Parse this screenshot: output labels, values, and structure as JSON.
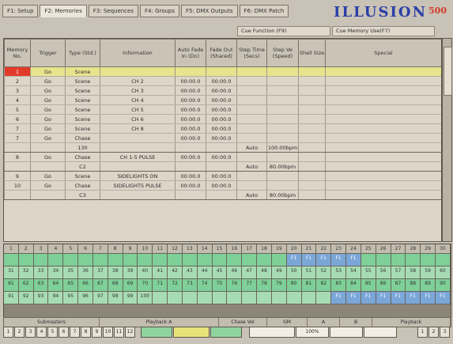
{
  "tabs": [
    "F1: Setup",
    "F2: Memories",
    "F3: Sequences",
    "F4: Groups",
    "F5: DMX Outputs",
    "F6: DMX Patch"
  ],
  "logo": {
    "main": "ILLUSION",
    "suffix": "500"
  },
  "subbar": {
    "left": "Cue Function (F9)",
    "right": "Cue Memory Use(F7)"
  },
  "headers": [
    "Memory No.",
    "Trigger",
    "Type (Std.)",
    "Information",
    "Auto Fade In (Dn)",
    "Fade Out (Shared)",
    "Step Time (Secs)",
    "Step Ve (Speed)",
    "Shell Size",
    "Special"
  ],
  "rows": [
    {
      "cells": [
        "1",
        "Go",
        "Scene",
        "",
        "",
        "",
        "",
        "",
        "",
        ""
      ],
      "selected": true
    },
    {
      "cells": [
        "2",
        "Go",
        "Scene",
        "CH 2",
        "00:00.0",
        "00:00.0",
        "",
        "",
        "",
        ""
      ]
    },
    {
      "cells": [
        "3",
        "Go",
        "Scene",
        "CH 3",
        "00:00.0",
        "00:00.0",
        "",
        "",
        "",
        ""
      ]
    },
    {
      "cells": [
        "4",
        "Go",
        "Scene",
        "CH 4",
        "00:00.0",
        "00:00.0",
        "",
        "",
        "",
        ""
      ]
    },
    {
      "cells": [
        "5",
        "Go",
        "Scene",
        "CH 5",
        "00:00.0",
        "00:00.0",
        "",
        "",
        "",
        ""
      ]
    },
    {
      "cells": [
        "6",
        "Go",
        "Scene",
        "CH 6",
        "00:00.0",
        "00:00.0",
        "",
        "",
        "",
        ""
      ]
    },
    {
      "cells": [
        "7",
        "Go",
        "Scene",
        "CH 8",
        "00:00.0",
        "00:00.0",
        "",
        "",
        "",
        ""
      ]
    },
    {
      "cells": [
        "7",
        "Go",
        "Chase",
        "",
        "00:00.0",
        "00:00.0",
        "",
        "",
        "",
        ""
      ]
    },
    {
      "cells": [
        "",
        "",
        "130",
        "",
        "",
        "",
        "Auto",
        "100.00bpm",
        "",
        ""
      ],
      "sep": true
    },
    {
      "cells": [
        "8",
        "Go",
        "Chase",
        "CH 1-5 PULSE",
        "00:00.0",
        "00:00.0",
        "",
        "",
        "",
        ""
      ]
    },
    {
      "cells": [
        "",
        "",
        "C2",
        "",
        "",
        "",
        "Auto",
        "80.00bpm",
        "",
        ""
      ],
      "sep": true
    },
    {
      "cells": [
        "9",
        "Go",
        "Scene",
        "SIDELIGHTS ON",
        "00:00.0",
        "00:00.0",
        "",
        "",
        "",
        ""
      ]
    },
    {
      "cells": [
        "10",
        "Go",
        "Chase",
        "SIDELIGHTS PULSE",
        "00:00.0",
        "00:00.0",
        "",
        "",
        "",
        ""
      ]
    },
    {
      "cells": [
        "",
        "",
        "C3",
        "",
        "",
        "",
        "Auto",
        "80.00bpm",
        "",
        ""
      ],
      "sep": true
    }
  ],
  "cue_numbers": [
    "1",
    "2",
    "3",
    "4",
    "5",
    "6",
    "7",
    "8",
    "9",
    "10",
    "11",
    "12",
    "13",
    "14",
    "15",
    "16",
    "17",
    "18",
    "19",
    "20",
    "21",
    "22",
    "23",
    "24",
    "25",
    "26",
    "27",
    "28",
    "29",
    "30"
  ],
  "cue_rows": [
    [
      "",
      "",
      "",
      "",
      "",
      "",
      "",
      "",
      "",
      "",
      "",
      "",
      "",
      "",
      "",
      "",
      "",
      "",
      "",
      "F1",
      "F1",
      "F1",
      "F1",
      "F1",
      "",
      "",
      "",
      "",
      "",
      ""
    ],
    [
      "31",
      "32",
      "33",
      "34",
      "35",
      "36",
      "37",
      "38",
      "39",
      "40",
      "41",
      "42",
      "43",
      "44",
      "45",
      "46",
      "47",
      "48",
      "49",
      "50",
      "51",
      "52",
      "53",
      "54",
      "55",
      "56",
      "57",
      "58",
      "59",
      "60"
    ],
    [
      "61",
      "62",
      "63",
      "64",
      "65",
      "66",
      "67",
      "68",
      "69",
      "70",
      "71",
      "72",
      "73",
      "74",
      "75",
      "76",
      "77",
      "78",
      "79",
      "80",
      "81",
      "82",
      "83",
      "84",
      "85",
      "86",
      "87",
      "88",
      "89",
      "90"
    ],
    [
      "91",
      "92",
      "93",
      "94",
      "95",
      "96",
      "97",
      "98",
      "99",
      "100",
      "",
      "",
      "",
      "",
      "",
      "",
      "",
      "",
      "",
      "",
      "",
      "",
      "F1",
      "F1",
      "F1",
      "F1",
      "F1",
      "F1",
      "F1",
      "F1"
    ]
  ],
  "status": [
    "Submasters",
    "Playback A",
    "Chase Vol",
    "GM",
    "A",
    "B",
    "Playback"
  ],
  "status_values": {
    "gm": "100%"
  },
  "keys_left": [
    "1",
    "2",
    "3",
    "4",
    "5",
    "6",
    "7",
    "8",
    "9",
    "10",
    "11",
    "12"
  ],
  "keys_right": [
    "1",
    "2",
    "3"
  ]
}
